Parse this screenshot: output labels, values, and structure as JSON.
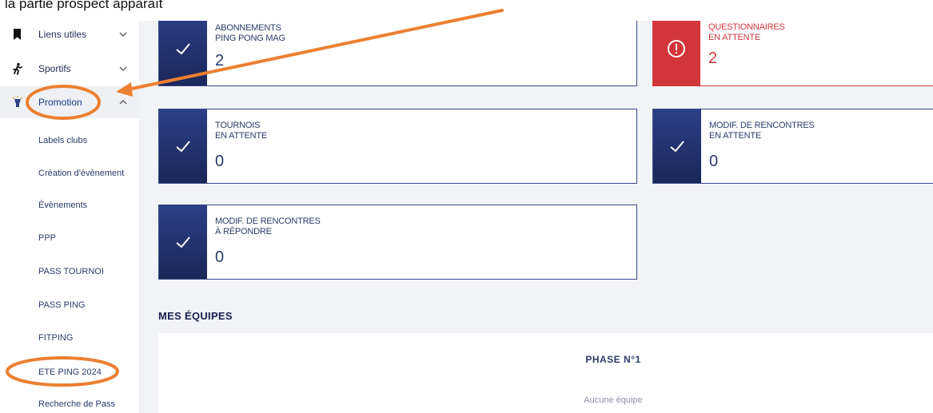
{
  "caption": {
    "text": "la partie prospect apparaît"
  },
  "sidebar": {
    "items": [
      {
        "label": "Liens utiles",
        "icon": "bookmark-icon"
      },
      {
        "label": "Sportifs",
        "icon": "runner-icon"
      },
      {
        "label": "Promotion",
        "icon": "lightbulb-icon"
      }
    ],
    "submenu": [
      "Labels clubs",
      "Création d'évènement",
      "Évènements",
      "PPP",
      "PASS TOURNOI",
      "PASS PING",
      "FITPING",
      "ETE PING 2024",
      "Recherche de Pass"
    ]
  },
  "cards": {
    "abonnements": {
      "line1": "ABONNEMENTS",
      "line2": "PING PONG MAG",
      "value": "2"
    },
    "questionnaires": {
      "line1": "QUESTIONNAIRES",
      "line2": "EN ATTENTE",
      "value": "2"
    },
    "tournois": {
      "line1": "TOURNOIS",
      "line2": "EN ATTENTE",
      "value": "0"
    },
    "modif_attente": {
      "line1": "MODIF. DE RENCONTRES",
      "line2": "EN ATTENTE",
      "value": "0"
    },
    "modif_repondre": {
      "line1": "MODIF. DE RENCONTRES",
      "line2": "À RÉPONDRE",
      "value": "0"
    }
  },
  "teams": {
    "section_title": "MES ÉQUIPES",
    "phase_title": "PHASE N°1",
    "empty_text": "Aucune équipe"
  },
  "colors": {
    "navy": "#1f2d66",
    "alert_red": "#d2363b",
    "annotation_orange": "#ec7f31"
  }
}
